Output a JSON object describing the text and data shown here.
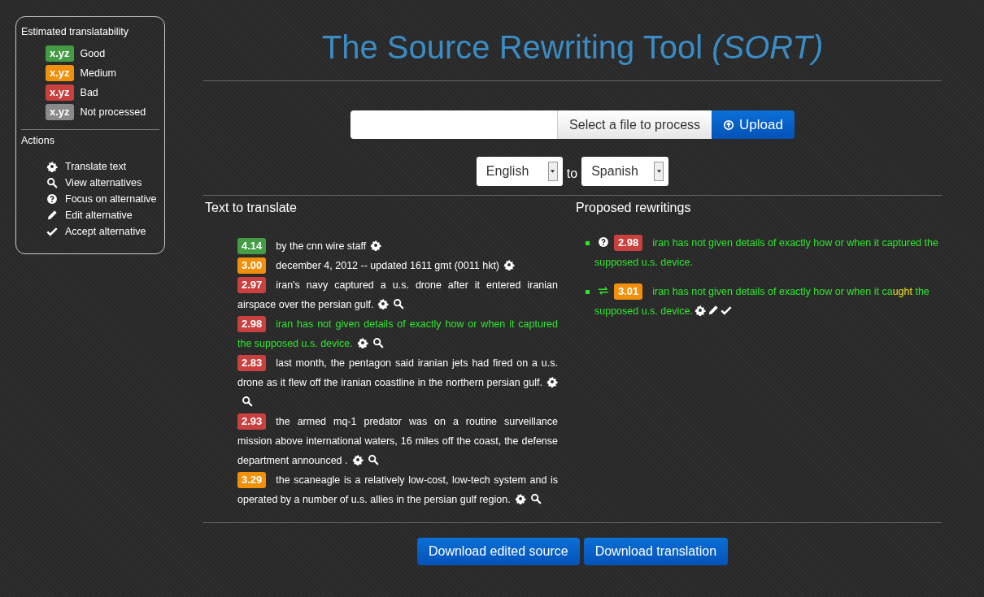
{
  "sidebar": {
    "legend_title": "Estimated translatability",
    "legend": [
      {
        "badge": "x.yz",
        "label": "Good",
        "color": "#449d44"
      },
      {
        "badge": "x.yz",
        "label": "Medium",
        "color": "#f0900b"
      },
      {
        "badge": "x.yz",
        "label": "Bad",
        "color": "#c9403e"
      },
      {
        "badge": "x.yz",
        "label": "Not processed",
        "color": "#8a8a8a"
      }
    ],
    "actions_title": "Actions",
    "actions": [
      {
        "kind": "translate",
        "label": "Translate text"
      },
      {
        "kind": "view",
        "label": "View alternatives"
      },
      {
        "kind": "focus",
        "label": "Focus on alternative"
      },
      {
        "kind": "edit",
        "label": "Edit alternative"
      },
      {
        "kind": "accept",
        "label": "Accept alternative"
      }
    ]
  },
  "title": "The Source Rewriting Tool *(SORT)*",
  "upload": {
    "file_button": "Select a file to process",
    "upload_button": "Upload"
  },
  "languages": {
    "source": "English",
    "connector": "to",
    "target": "Spanish"
  },
  "source_panel": {
    "heading": "Text to translate",
    "sentences": [
      {
        "score": "4.14",
        "color": "#449d44",
        "text": "by the cnn wire staff",
        "highlighted": false,
        "actions": [
          {
            "kind": "translate"
          }
        ]
      },
      {
        "score": "3.00",
        "color": "#f0900b",
        "text": "december 4, 2012 -- updated 1611 gmt (0011 hkt)",
        "highlighted": false,
        "actions": [
          {
            "kind": "translate"
          }
        ]
      },
      {
        "score": "2.97",
        "color": "#c9403e",
        "text": "iran's navy captured a u.s. drone after it entered iranian airspace over the persian gulf.",
        "highlighted": false,
        "actions": [
          {
            "kind": "translate"
          },
          {
            "kind": "view"
          }
        ]
      },
      {
        "score": "2.98",
        "color": "#c9403e",
        "text": "iran has not given details of exactly how or when it captured the supposed u.s. device.",
        "highlighted": true,
        "actions": [
          {
            "kind": "translate"
          },
          {
            "kind": "view"
          }
        ]
      },
      {
        "score": "2.83",
        "color": "#c9403e",
        "text": "last month, the pentagon said iranian jets had fired on a u.s. drone as it flew off the iranian coastline in the northern persian gulf.",
        "highlighted": false,
        "actions": [
          {
            "kind": "translate"
          },
          {
            "kind": "view"
          }
        ]
      },
      {
        "score": "2.93",
        "color": "#c9403e",
        "text": "the armed mq-1 predator was on a routine surveillance mission above international waters, 16 miles off the coast, the defense department announced .",
        "highlighted": false,
        "actions": [
          {
            "kind": "translate"
          },
          {
            "kind": "view"
          }
        ]
      },
      {
        "score": "3.29",
        "color": "#f0900b",
        "text": "the scaneagle is a relatively low-cost, low-tech system and is operated by a number of u.s. allies in the persian gulf region.",
        "highlighted": false,
        "actions": [
          {
            "kind": "translate"
          },
          {
            "kind": "view"
          }
        ]
      }
    ]
  },
  "rewrite_panel": {
    "heading": "Proposed rewritings",
    "rewritings": [
      {
        "kind": "focus",
        "score": "2.98",
        "color": "#c9403e",
        "segments": [
          {
            "text": "iran has not given details of exactly how or when it captured the supposed u.s. device.",
            "changed": false
          }
        ]
      },
      {
        "kind": "swap",
        "score": "3.01",
        "color": "#f0900b",
        "segments": [
          {
            "text": "iran has not given details of exactly how or when it ca",
            "changed": false
          },
          {
            "text": "ught",
            "changed": true
          },
          {
            "text": " the supposed u.s. device.",
            "changed": false
          }
        ],
        "actions": [
          {
            "kind": "translate"
          },
          {
            "kind": "edit"
          },
          {
            "kind": "accept"
          }
        ]
      }
    ]
  },
  "downloads": [
    "Download edited source",
    "Download translation"
  ]
}
